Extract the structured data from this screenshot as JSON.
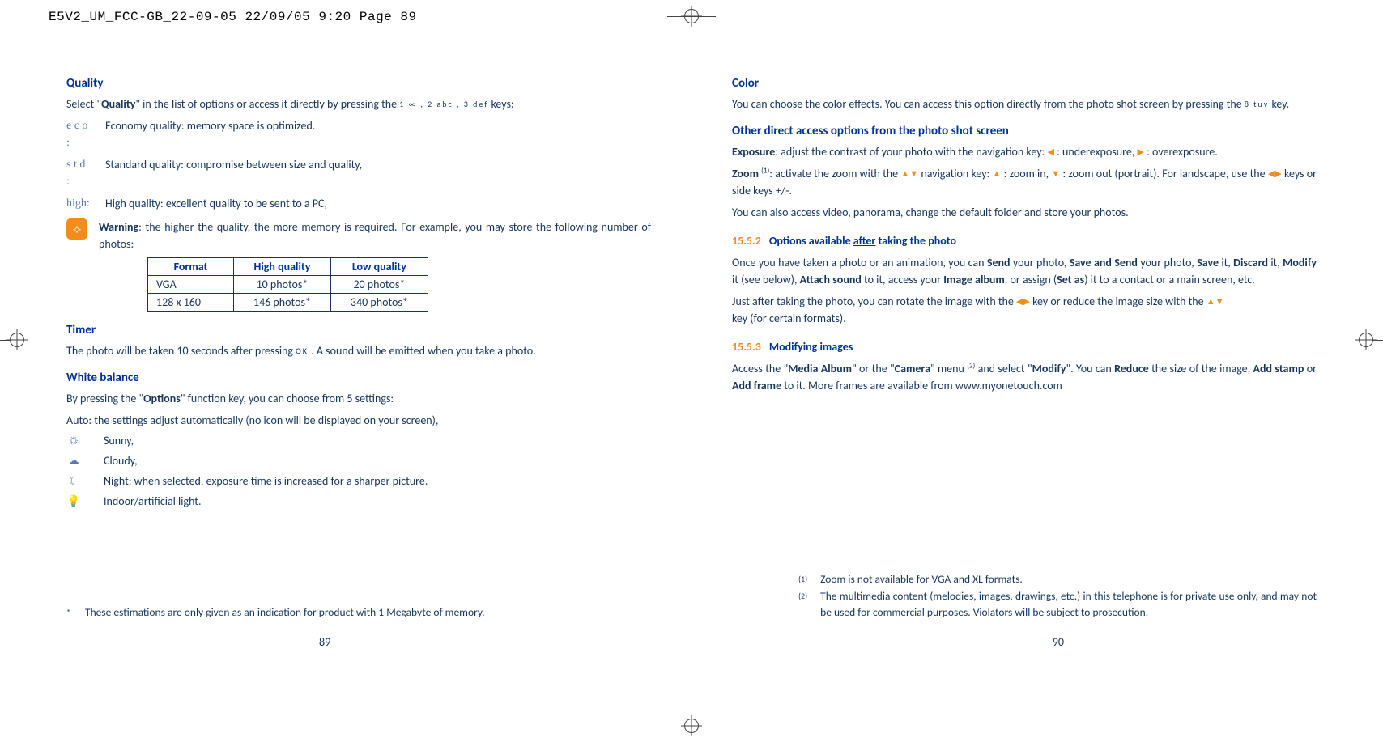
{
  "header": "E5V2_UM_FCC-GB_22-09-05  22/09/05  9:20  Page 89",
  "left": {
    "quality": {
      "heading": "Quality",
      "intro_pre": "Select \"",
      "intro_bold": "Quality",
      "intro_post": "\" in the list of options or access it directly by pressing the ",
      "intro_keys": "1 ∞ , 2 abc , 3 def",
      "intro_end": " keys:",
      "items": [
        {
          "icon": "e c o :",
          "text": "Economy quality: memory space is optimized."
        },
        {
          "icon": "s t d :",
          "text": "Standard quality: compromise between size and quality,"
        },
        {
          "icon": "high:",
          "text": "High quality: excellent quality to be sent to a PC,"
        }
      ],
      "warning_label": "Warning",
      "warning_text": ": the higher the quality, the more memory is required. For example, you may store the following number of photos:",
      "table": {
        "headers": [
          "Format",
          "High quality",
          "Low quality"
        ],
        "rows": [
          [
            "VGA",
            "10 photos*",
            "20 photos*"
          ],
          [
            "128 x 160",
            "146 photos*",
            "340 photos*"
          ]
        ]
      }
    },
    "timer": {
      "heading": "Timer",
      "text_pre": "The photo will be taken 10 seconds after pressing ",
      "text_key": "OK",
      "text_post": " . A sound will be emitted when you take a photo."
    },
    "wb": {
      "heading": "White balance",
      "intro_pre": "By pressing the \"",
      "intro_bold": "Options",
      "intro_post": "\" function key, you can choose from 5 settings:",
      "auto": "Auto: the settings adjust automatically (no icon will be displayed on your screen),",
      "items": [
        {
          "icon": "☼",
          "text": "Sunny,"
        },
        {
          "icon": "☁",
          "text": "Cloudy,"
        },
        {
          "icon": "☾",
          "text": "Night: when selected, exposure time is increased for a sharper picture."
        },
        {
          "icon": "💡",
          "text": "Indoor/artificial light."
        }
      ]
    },
    "footnote": {
      "mark": "*",
      "text": "These estimations are only given as an indication for product with 1 Megabyte of memory."
    },
    "pagenum": "89"
  },
  "right": {
    "color": {
      "heading": "Color",
      "text_pre": "You can choose the color effects. You can access this option directly from the photo shot screen by pressing the ",
      "key": "8 tuv",
      "text_post": " key."
    },
    "direct": {
      "heading": "Other direct access options from the photo shot screen",
      "exposure_label": "Exposure",
      "exposure_text": ": adjust the contrast of your photo with the navigation key: ",
      "exposure_under": " : underexposure, ",
      "exposure_over": " : overexposure.",
      "zoom_label": "Zoom ",
      "zoom_sup": "(1)",
      "zoom_text1": ": activate the zoom with the ",
      "zoom_text2": " navigation key: ",
      "zoom_in": " : zoom in, ",
      "zoom_out": " : zoom out (portrait). For landscape, use the ",
      "zoom_end": " keys or side keys +/-.",
      "also": "You can also access video, panorama, change the default folder and store your photos."
    },
    "s1552": {
      "num": "15.5.2",
      "title": "Options available after taking the photo",
      "title_underline": "after",
      "p1_pre": "Once you have taken a photo or an animation, you can ",
      "p1": "Send your photo, Save and Send your photo, Save it, Discard it, Modify it (see below), Attach sound to it, access your Image album, or assign (Set as) it to a contact or a main screen, etc.",
      "p2_pre": "Just after taking the photo, you can rotate the image with the ",
      "p2_mid": " key or reduce the image size with the ",
      "p2_end": " key (for certain formats)."
    },
    "s1553": {
      "num": "15.5.3",
      "title": "Modifying images",
      "p_pre": "Access the \"",
      "p_b1": "Media Album",
      "p_mid1": "\" or the \"",
      "p_b2": "Camera",
      "p_mid2": "\" menu ",
      "p_sup": "(2)",
      "p_mid3": " and select \"",
      "p_b3": "Modify",
      "p_mid4": "\". You can ",
      "p_b4": "Reduce",
      "p_mid5": " the size of the image, ",
      "p_b5": "Add stamp",
      "p_mid6": " or ",
      "p_b6": "Add frame",
      "p_end": " to it. More frames are available from www.myonetouch.com"
    },
    "footnotes": [
      {
        "mark": "(1)",
        "text": "Zoom is not available for VGA and XL formats."
      },
      {
        "mark": "(2)",
        "text": "The multimedia content (melodies, images, drawings, etc.) in this telephone is for private use only, and may not be used for commercial purposes. Violators will be subject to prosecution."
      }
    ],
    "pagenum": "90"
  }
}
